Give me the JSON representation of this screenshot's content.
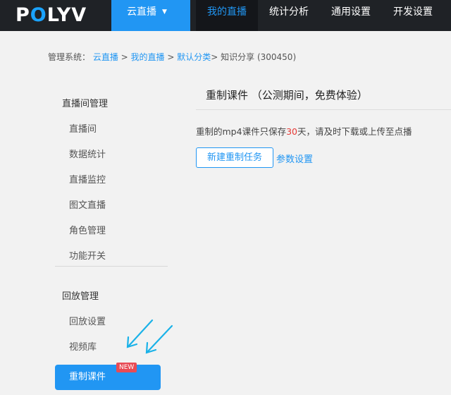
{
  "header": {
    "logo_prefix": "P",
    "logo_o": "O",
    "logo_suffix": "LYV",
    "nav_cloud_label": "云直播",
    "nav_items": [
      {
        "label": "我的直播"
      },
      {
        "label": "统计分析"
      },
      {
        "label": "通用设置"
      },
      {
        "label": "开发设置"
      }
    ]
  },
  "breadcrumb": {
    "prefix": "管理系统：",
    "link1": "云直播",
    "sep1": " > ",
    "link2": "我的直播",
    "sep2": " > ",
    "link3": "默认分类",
    "tail": "> 知识分享 (300450)"
  },
  "sidebar": {
    "group1_title": "直播间管理",
    "group1_items": [
      "直播间",
      "数据统计",
      "直播监控",
      "图文直播",
      "角色管理",
      "功能开关"
    ],
    "group2_title": "回放管理",
    "group2_items": [
      "回放设置",
      "视频库"
    ],
    "active_item": "重制课件",
    "new_badge": "NEW"
  },
  "main": {
    "title": "重制课件 （公测期间，免费体验）",
    "notice_before": "重制的mp4课件只保存",
    "notice_days": "30",
    "notice_after": "天，请及时下载或上传至点播",
    "new_task_button": "新建重制任务",
    "params_link": "参数设置"
  },
  "colors": {
    "accent": "#2196f3",
    "topbar_bg": "#1f2226",
    "badge_red": "#e84b55",
    "arrow_cyan": "#1ab2e8"
  }
}
